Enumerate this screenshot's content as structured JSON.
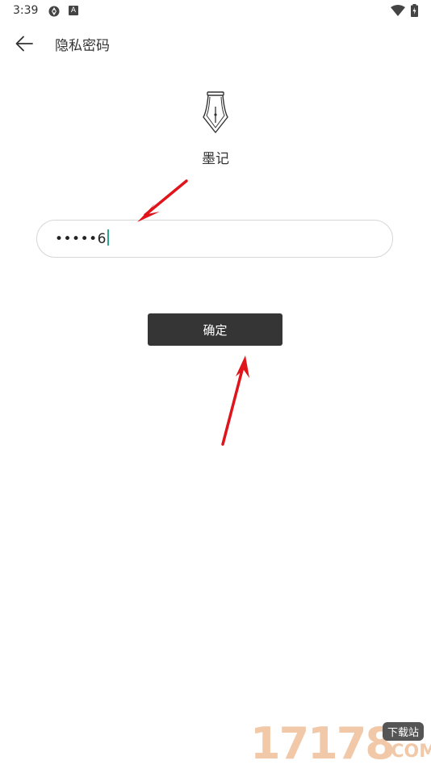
{
  "status_bar": {
    "time": "3:39",
    "icons": [
      "sync-icon",
      "a-badge-icon",
      "wifi-icon",
      "battery-icon"
    ],
    "badge_letter": "A"
  },
  "header": {
    "title": "隐私密码",
    "back_icon": "arrow-left-icon"
  },
  "logo": {
    "icon": "fountain-pen-icon",
    "app_name": "墨记"
  },
  "password": {
    "masked_value": "•••••6"
  },
  "confirm": {
    "label": "确定"
  },
  "colors": {
    "button_bg": "#353535",
    "button_text": "#ffffff",
    "field_border": "#d6d6d6",
    "cursor": "#2aa58e",
    "annotation_arrow": "#e0141b",
    "watermark": "#f2c9a8"
  },
  "watermark": {
    "main": "17178",
    "badge": "下载站",
    "sub": ".COM"
  }
}
